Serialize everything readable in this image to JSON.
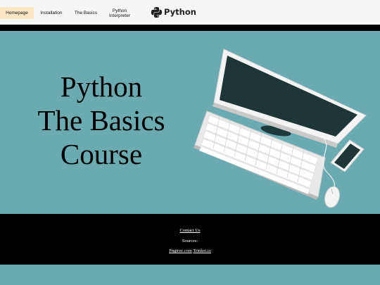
{
  "nav": {
    "items": [
      {
        "label": "Homepage",
        "active": true
      },
      {
        "label": "Installation",
        "active": false
      },
      {
        "label": "The Basics",
        "active": false
      },
      {
        "label": "Python Interpreter",
        "active": false
      }
    ],
    "logo_text": "Python"
  },
  "hero": {
    "title_lines": [
      "Python",
      "The Basics",
      "Course"
    ]
  },
  "footer": {
    "contact": "Contact Us",
    "sources": "Sources:",
    "link1": "Pngtree.com",
    "link2": "Trinket.io"
  },
  "colors": {
    "background": "#6aabb2",
    "nav_bg": "#f5f5f5",
    "active_tab": "#fbe7c6",
    "footer_bg": "#000000",
    "python_blue": "#3a6e9e",
    "python_yellow": "#f4c843"
  }
}
